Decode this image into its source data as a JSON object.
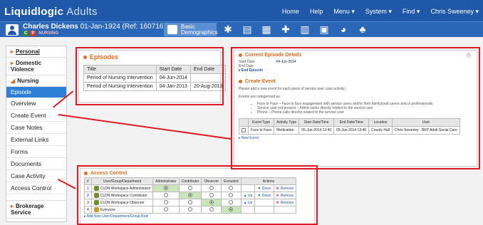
{
  "app": {
    "brand": "Liquidlogic",
    "module": "Adults"
  },
  "topnav": [
    "Home",
    "Help",
    "Menu ▾",
    "System ▾",
    "Find ▾",
    "Chris Sweeney ▾"
  ],
  "patient": {
    "name": "Charles Dickens",
    "dob": "01-Jan-1924 (Ref: 160716)",
    "badge_c": "C",
    "badge_p": "P",
    "badge_n": "NURSING"
  },
  "basic_demo": "Basic Demographics",
  "sidebar": {
    "personal": "Personal",
    "domestic": "Domestic Violence",
    "nursing": "Nursing",
    "active": "Episode",
    "items": [
      "Overview",
      "Create Event",
      "Case Notes",
      "External Links",
      "Forms",
      "Documents",
      "Case Activity",
      "Access Control"
    ],
    "brokerage": "Brokerage Service"
  },
  "episodes": {
    "title": "Episodes",
    "headers": [
      "Title",
      "Start Date",
      "End Date"
    ],
    "rows": [
      [
        "Period of Nursing Intervention",
        "04-Jun-2014",
        ""
      ],
      [
        "Period of Nursing Intervention",
        "04-Jan-2013",
        "20-Aug-2013"
      ]
    ]
  },
  "current": {
    "title": "Current Episode Details",
    "start_label": "Start Date",
    "start_value": "04-Jun-2014",
    "end_label": "End Date",
    "end_link": "End Episode"
  },
  "create": {
    "title": "Create Event",
    "intro": "Please add a new event for each piece of service user case activity.",
    "cat": "Events are categorised as:",
    "bullets": [
      "Face to Face – Face to face engagement with service users and/or their family/paid carers and or professionals",
      "Service user not present – Admin tasks directly related to the service user",
      "Phone – Phone calls directly related to the service user"
    ],
    "headers": [
      "Event Type",
      "Activity Type",
      "Start Date/Time",
      "End Date/Time",
      "Location",
      "User"
    ],
    "row": [
      "Face to Face",
      "Medication",
      "05-Jun-2014 13:40",
      "05-Jun-2014 13:40",
      "County Hall",
      "Chris Sweeney - BKP Adult Social Care"
    ],
    "new_event": "New Event"
  },
  "access": {
    "title": "Access Control",
    "headers": [
      "#",
      "User/Group/Department",
      "Administrator",
      "Contributor",
      "Observer",
      "Excluded",
      "Actions"
    ],
    "rows": [
      {
        "n": "1",
        "name": "CLDN Workspace Administrator",
        "sel": "Administrator",
        "up": "",
        "down": "Down",
        "remove": "Remove"
      },
      {
        "n": "2",
        "name": "CLDN Workspace Contributor",
        "sel": "Contributor",
        "up": "Up",
        "down": "Down",
        "remove": "Remove"
      },
      {
        "n": "3",
        "name": "CLDN Workspace Observer",
        "sel": "Observer",
        "up": "Up",
        "down": "",
        "remove": "Remove"
      },
      {
        "n": "4",
        "name": "Everyone",
        "sel": "Excluded",
        "up": "",
        "down": "",
        "remove": ""
      }
    ],
    "add_link": "Add New User/Department/Group Rule"
  }
}
